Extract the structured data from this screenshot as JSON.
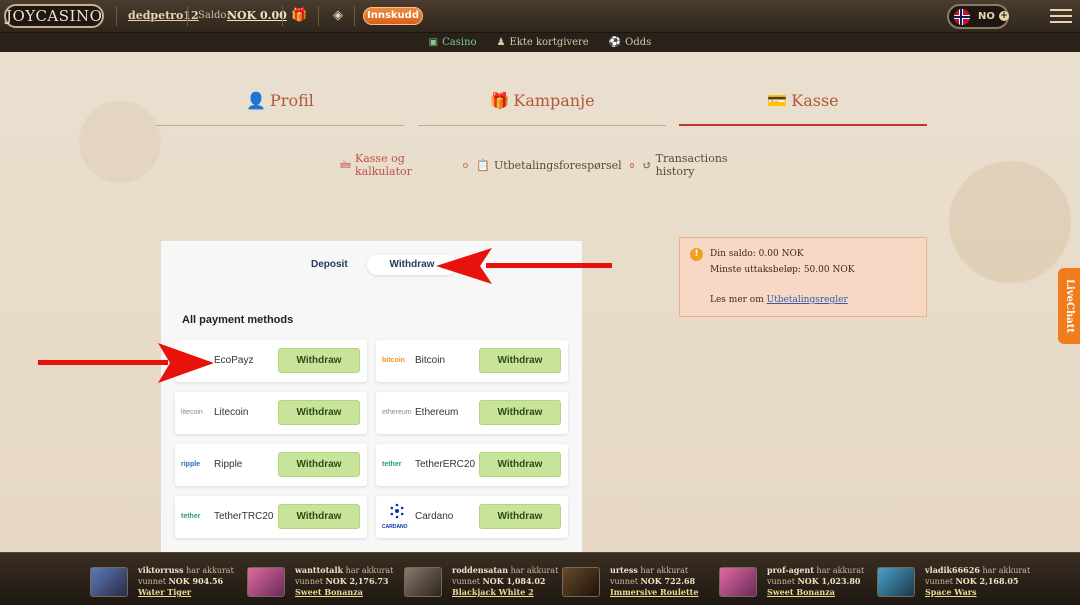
{
  "topbar": {
    "logo": "JOYCASINO",
    "username": "dedpetro12",
    "saldo_label": "Saldo:",
    "saldo_value": "NOK 0.00",
    "deposit_label": "Innskudd",
    "language": "NO"
  },
  "subnav": {
    "items": [
      {
        "label": "Casino",
        "icon": "slot-icon"
      },
      {
        "label": "Ekte kortgivere",
        "icon": "dealer-icon"
      },
      {
        "label": "Odds",
        "icon": "ball-icon"
      }
    ]
  },
  "tabs": {
    "profil": "Profil",
    "kampanje": "Kampanje",
    "kasse": "Kasse"
  },
  "subtabs": {
    "kasse": "Kasse og kalkulator",
    "utbetaling": "Utbetalingsforespørsel",
    "history": "Transactions history"
  },
  "payment": {
    "deposit_tab": "Deposit",
    "withdraw_tab": "Withdraw",
    "heading": "All payment methods",
    "methods": [
      {
        "name": "EcoPayz",
        "logo": "",
        "button": "Withdraw"
      },
      {
        "name": "Bitcoin",
        "logo": "bitcoin",
        "button": "Withdraw"
      },
      {
        "name": "Litecoin",
        "logo": "litecoin",
        "button": "Withdraw"
      },
      {
        "name": "Ethereum",
        "logo": "ethereum",
        "button": "Withdraw"
      },
      {
        "name": "Ripple",
        "logo": "ripple",
        "button": "Withdraw"
      },
      {
        "name": "TetherERC20",
        "logo": "tether",
        "button": "Withdraw"
      },
      {
        "name": "TetherTRC20",
        "logo": "tether",
        "button": "Withdraw"
      },
      {
        "name": "Cardano",
        "logo": "CARDANO",
        "button": "Withdraw"
      }
    ]
  },
  "info": {
    "line1": "Din saldo: 0.00 NOK",
    "line2": "Minste uttaksbeløp: 50.00 NOK",
    "line3_prefix": "Les mer om",
    "line3_link": "Utbetalingsregler"
  },
  "livechat": "LiveChatt",
  "winners": [
    {
      "user": "viktorruss",
      "text": "har akkurat",
      "won": "vunnet",
      "amount": "NOK 904.56",
      "game": "Water Tiger"
    },
    {
      "user": "wanttotalk",
      "text": "har akkurat",
      "won": "vunnet",
      "amount": "NOK 2,176.73",
      "game": "Sweet Bonanza"
    },
    {
      "user": "roddensatan",
      "text": "har akkurat",
      "won": "vunnet",
      "amount": "NOK 1,084.02",
      "game": "Blackjack White 2"
    },
    {
      "user": "urtess",
      "text": "har akkurat",
      "won": "vunnet",
      "amount": "NOK 722.68",
      "game": "Immersive Roulette"
    },
    {
      "user": "prof-agent",
      "text": "har akkurat",
      "won": "vunnet",
      "amount": "NOK 1,023.80",
      "game": "Sweet Bonanza"
    },
    {
      "user": "vladik66626",
      "text": "har akkurat",
      "won": "vunnet",
      "amount": "NOK 2,168.05",
      "game": "Space Wars"
    }
  ],
  "colors": {
    "accent": "#c0392b",
    "button_green": "#c8e49a",
    "deposit_orange": "#f08a3c",
    "info_bg": "#f7d8c4"
  }
}
